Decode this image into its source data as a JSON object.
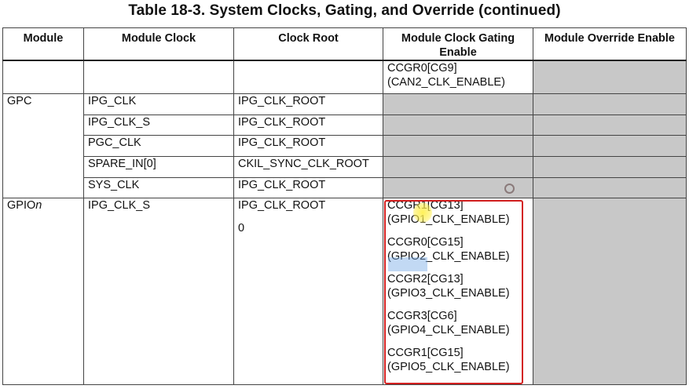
{
  "title": "Table 18-3.   System Clocks, Gating, and Override (continued)",
  "headers": {
    "module": "Module",
    "module_clock": "Module Clock",
    "clock_root": "Clock Root",
    "gating": "Module Clock Gating Enable",
    "override": "Module Override Enable"
  },
  "rows": {
    "can2": {
      "gating_1": "CCGR0[CG9]",
      "gating_2": "(CAN2_CLK_ENABLE)"
    },
    "gpc": {
      "module": "GPC",
      "r1": {
        "clock": "IPG_CLK",
        "root": "IPG_CLK_ROOT"
      },
      "r2": {
        "clock": "IPG_CLK_S",
        "root": "IPG_CLK_ROOT"
      },
      "r3": {
        "clock": "PGC_CLK",
        "root": "IPG_CLK_ROOT"
      },
      "r4": {
        "clock": "SPARE_IN[0]",
        "root": "CKIL_SYNC_CLK_ROOT"
      },
      "r5": {
        "clock": "SYS_CLK",
        "root": "IPG_CLK_ROOT"
      }
    },
    "gpio": {
      "module_prefix": "GPIO",
      "module_suffix": "n",
      "clock": "IPG_CLK_S",
      "root_1": "IPG_CLK_ROOT",
      "root_2": "0",
      "gating": [
        {
          "reg": "CCGR1[CG13]",
          "name": "(GPIO1_CLK_ENABLE)"
        },
        {
          "reg": "CCGR0[CG15]",
          "name": "(GPIO2_CLK_ENABLE)"
        },
        {
          "reg": "CCGR2[CG13]",
          "name": "(GPIO3_CLK_ENABLE)"
        },
        {
          "reg": "CCGR3[CG6]",
          "name": "(GPIO4_CLK_ENABLE)"
        },
        {
          "reg": "CCGR1[CG15]",
          "name": "(GPIO5_CLK_ENABLE)"
        }
      ]
    }
  },
  "colors": {
    "override_fill": "#c8c8c8",
    "annotation_box": "#d32020",
    "cursor_highlight": "#fff050",
    "selection": "#78aae6"
  }
}
